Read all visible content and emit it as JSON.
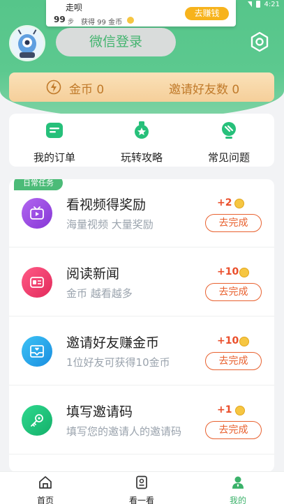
{
  "status_bar": {
    "time": "4:21"
  },
  "notification": {
    "title": "走呗",
    "steps": "99",
    "steps_unit": "步",
    "earned_text": "获得 99 金币",
    "action_label": "去赚钱"
  },
  "header": {
    "login_label": "微信登录",
    "icons": {
      "avatar": "alien-avatar",
      "settings": "gear-icon"
    }
  },
  "coin_bar": {
    "coins_label": "金币 0",
    "invites_label": "邀请好友数 0"
  },
  "menu": {
    "items": [
      {
        "label": "我的订单",
        "icon": "order-icon"
      },
      {
        "label": "玩转攻略",
        "icon": "guide-medal-icon"
      },
      {
        "label": "常见问题",
        "icon": "question-bulb-icon"
      }
    ]
  },
  "tasks": {
    "section_tag": "日常任务",
    "items": [
      {
        "title": "看视频得奖励",
        "subtitle": "海量视频 大量奖励",
        "reward": "+2",
        "action": "去完成",
        "icon": "tv-icon",
        "color": "#9b4de0"
      },
      {
        "title": "阅读新闻",
        "subtitle": "金币 越看越多",
        "reward": "+10",
        "action": "去完成",
        "icon": "news-card-icon",
        "color": "#ee3c6b"
      },
      {
        "title": "邀请好友赚金币",
        "subtitle": "1位好友可获得10金币",
        "reward": "+10",
        "action": "去完成",
        "icon": "invite-envelope-icon",
        "color": "#1f9ee8"
      },
      {
        "title": "填写邀请码",
        "subtitle": "填写您的邀请人的邀请码",
        "reward": "+1",
        "action": "去完成",
        "icon": "key-icon",
        "color": "#1fc07a"
      }
    ]
  },
  "bottom_nav": {
    "items": [
      {
        "label": "首页",
        "icon": "home-icon",
        "active": false
      },
      {
        "label": "看一看",
        "icon": "watch-card-icon",
        "active": false
      },
      {
        "label": "我的",
        "icon": "person-icon",
        "active": true
      }
    ]
  },
  "colors": {
    "primary_green": "#4cbb78",
    "reward_red": "#ea4e2b",
    "coin_gold": "#f6c642"
  }
}
